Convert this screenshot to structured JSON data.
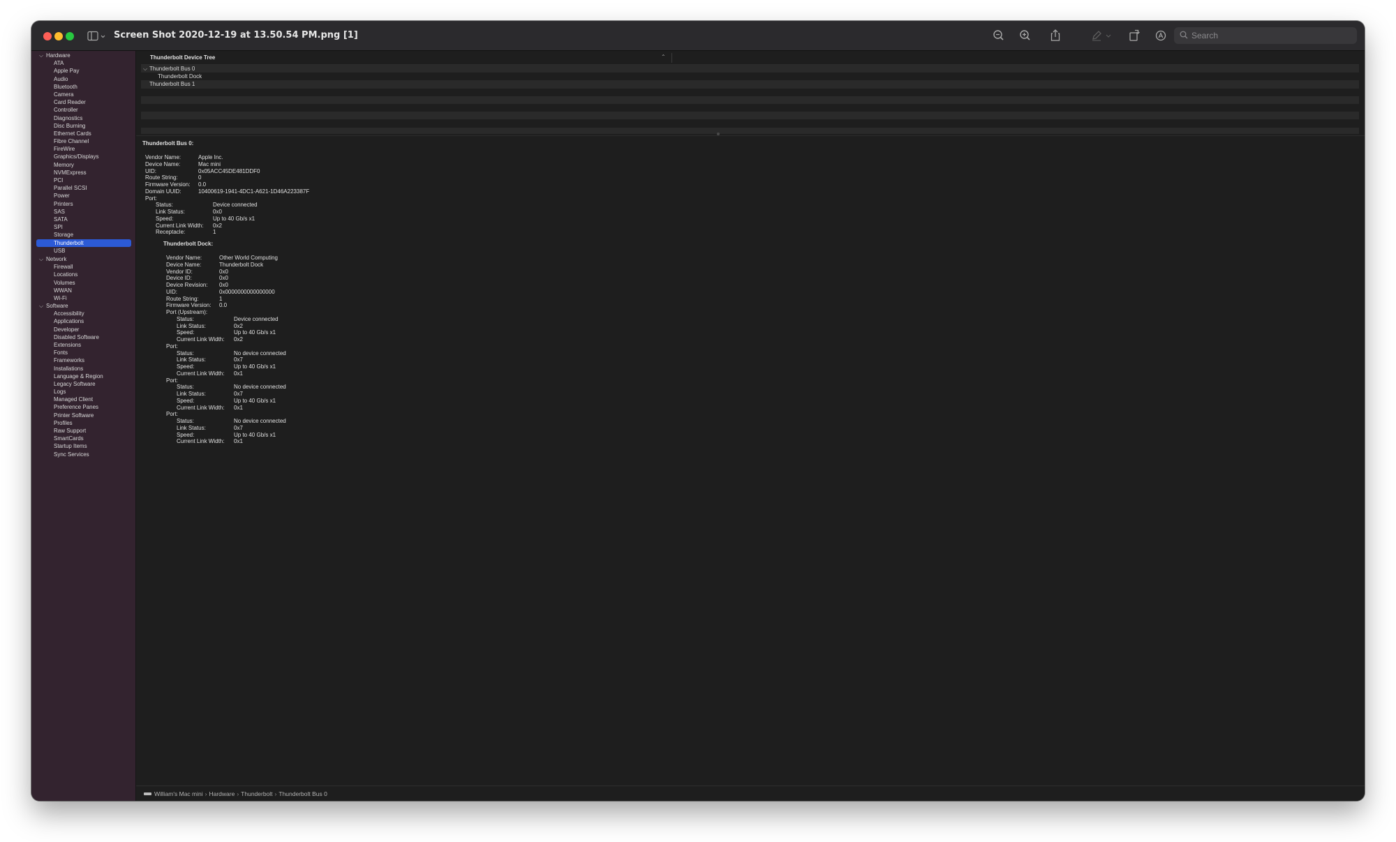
{
  "window": {
    "title": "Screen Shot 2020-12-19 at 13.50.54 PM.png [1]"
  },
  "toolbar": {
    "search_placeholder": "Search",
    "icons": [
      "zoom-out-icon",
      "zoom-in-icon",
      "share-icon",
      "markup-icon",
      "rotate-icon",
      "annotate-icon"
    ]
  },
  "sidebar": {
    "hardware": {
      "label": "Hardware",
      "items": [
        "ATA",
        "Apple Pay",
        "Audio",
        "Bluetooth",
        "Camera",
        "Card Reader",
        "Controller",
        "Diagnostics",
        "Disc Burning",
        "Ethernet Cards",
        "Fibre Channel",
        "FireWire",
        "Graphics/Displays",
        "Memory",
        "NVMExpress",
        "PCI",
        "Parallel SCSI",
        "Power",
        "Printers",
        "SAS",
        "SATA",
        "SPI",
        "Storage",
        "Thunderbolt",
        "USB"
      ],
      "selected": "Thunderbolt"
    },
    "network": {
      "label": "Network",
      "items": [
        "Firewall",
        "Locations",
        "Volumes",
        "WWAN",
        "Wi-Fi"
      ]
    },
    "software": {
      "label": "Software",
      "items": [
        "Accessibility",
        "Applications",
        "Developer",
        "Disabled Software",
        "Extensions",
        "Fonts",
        "Frameworks",
        "Installations",
        "Language & Region",
        "Legacy Software",
        "Logs",
        "Managed Client",
        "Preference Panes",
        "Printer Software",
        "Profiles",
        "Raw Support",
        "SmartCards",
        "Startup Items",
        "Sync Services"
      ]
    }
  },
  "tree": {
    "header": "Thunderbolt Device Tree",
    "rows": [
      {
        "label": "Thunderbolt Bus 0",
        "level": 0,
        "expanded": true
      },
      {
        "label": "Thunderbolt Dock",
        "level": 1
      },
      {
        "label": "Thunderbolt Bus 1",
        "level": 0
      }
    ]
  },
  "details": {
    "bus_title": "Thunderbolt Bus 0:",
    "bus_fields": [
      {
        "key": "Vendor Name:",
        "value": "Apple Inc."
      },
      {
        "key": "Device Name:",
        "value": "Mac mini"
      },
      {
        "key": "UID:",
        "value": "0x05ACC45DE481DDF0"
      },
      {
        "key": "Route String:",
        "value": "0"
      },
      {
        "key": "Firmware Version:",
        "value": "0.0"
      },
      {
        "key": "Domain UUID:",
        "value": "10400619-1941-4DC1-A621-1D46A223387F"
      },
      {
        "key": "Port:",
        "value": ""
      }
    ],
    "bus_port": [
      {
        "key": "Status:",
        "value": "Device connected"
      },
      {
        "key": "Link Status:",
        "value": "0x0"
      },
      {
        "key": "Speed:",
        "value": "Up to 40 Gb/s x1"
      },
      {
        "key": "Current Link Width:",
        "value": "0x2"
      },
      {
        "key": "Receptacle:",
        "value": "1"
      }
    ],
    "dock_title": "Thunderbolt Dock:",
    "dock_fields": [
      {
        "key": "Vendor Name:",
        "value": "Other World Computing"
      },
      {
        "key": "Device Name:",
        "value": "Thunderbolt Dock"
      },
      {
        "key": "Vendor ID:",
        "value": "0x0"
      },
      {
        "key": "Device ID:",
        "value": "0x0"
      },
      {
        "key": "Device Revision:",
        "value": "0x0"
      },
      {
        "key": "UID:",
        "value": "0x0000000000000000"
      },
      {
        "key": "Route String:",
        "value": "1"
      },
      {
        "key": "Firmware Version:",
        "value": "0.0"
      }
    ],
    "dock_ports": [
      {
        "label": "Port (Upstream):",
        "fields": [
          {
            "key": "Status:",
            "value": "Device connected"
          },
          {
            "key": "Link Status:",
            "value": "0x2"
          },
          {
            "key": "Speed:",
            "value": "Up to 40 Gb/s x1"
          },
          {
            "key": "Current Link Width:",
            "value": "0x2"
          }
        ]
      },
      {
        "label": "Port:",
        "fields": [
          {
            "key": "Status:",
            "value": "No device connected"
          },
          {
            "key": "Link Status:",
            "value": "0x7"
          },
          {
            "key": "Speed:",
            "value": "Up to 40 Gb/s x1"
          },
          {
            "key": "Current Link Width:",
            "value": "0x1"
          }
        ]
      },
      {
        "label": "Port:",
        "fields": [
          {
            "key": "Status:",
            "value": "No device connected"
          },
          {
            "key": "Link Status:",
            "value": "0x7"
          },
          {
            "key": "Speed:",
            "value": "Up to 40 Gb/s x1"
          },
          {
            "key": "Current Link Width:",
            "value": "0x1"
          }
        ]
      },
      {
        "label": "Port:",
        "fields": [
          {
            "key": "Status:",
            "value": "No device connected"
          },
          {
            "key": "Link Status:",
            "value": "0x7"
          },
          {
            "key": "Speed:",
            "value": "Up to 40 Gb/s x1"
          },
          {
            "key": "Current Link Width:",
            "value": "0x1"
          }
        ]
      }
    ]
  },
  "breadcrumb": [
    "William's Mac mini",
    "Hardware",
    "Thunderbolt",
    "Thunderbolt Bus 0"
  ],
  "colors": {
    "sidebar_bg": "#33232f",
    "selection": "#2c5ad6",
    "content_bg": "#1e1e1e"
  }
}
